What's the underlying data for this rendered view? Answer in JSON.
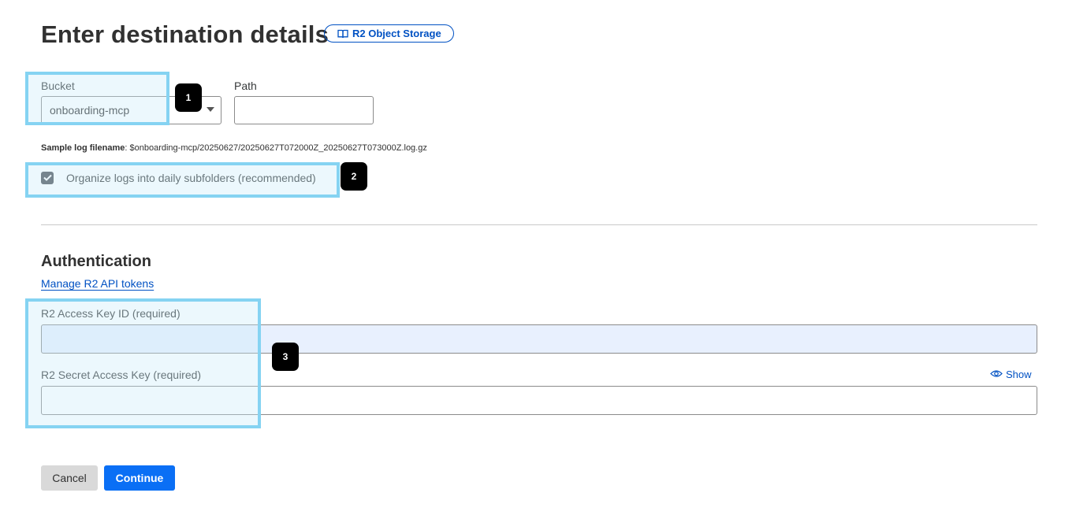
{
  "header": {
    "title": "Enter destination details",
    "badge_label": "R2 Object Storage"
  },
  "bucket": {
    "label": "Bucket",
    "value": "onboarding-mcp"
  },
  "path": {
    "label": "Path",
    "value": ""
  },
  "sample": {
    "label": "Sample log filename",
    "value": ": $onboarding-mcp/20250627/20250627T072000Z_20250627T073000Z.log.gz"
  },
  "daily_subfolders": {
    "label": "Organize logs into daily subfolders (recommended)",
    "checked": true
  },
  "authentication": {
    "title": "Authentication",
    "manage_link": "Manage R2 API tokens",
    "access_key_label": "R2 Access Key ID (required)",
    "secret_key_label": "R2 Secret Access Key (required)",
    "show_label": "Show"
  },
  "actions": {
    "cancel_label": "Cancel",
    "continue_label": "Continue"
  },
  "annotations": {
    "marker_1": "1",
    "marker_2": "2",
    "marker_3": "3"
  },
  "colors": {
    "accent": "#0051c3",
    "primary_button": "#0a6ff5",
    "highlight_border": "#85d3f2",
    "autofill_input": "#e8f0fe"
  },
  "icons": {
    "badge_icon": "book-icon",
    "show_icon": "eye-icon",
    "checkbox_icon": "check-icon",
    "select_icon": "caret-down-icon"
  }
}
